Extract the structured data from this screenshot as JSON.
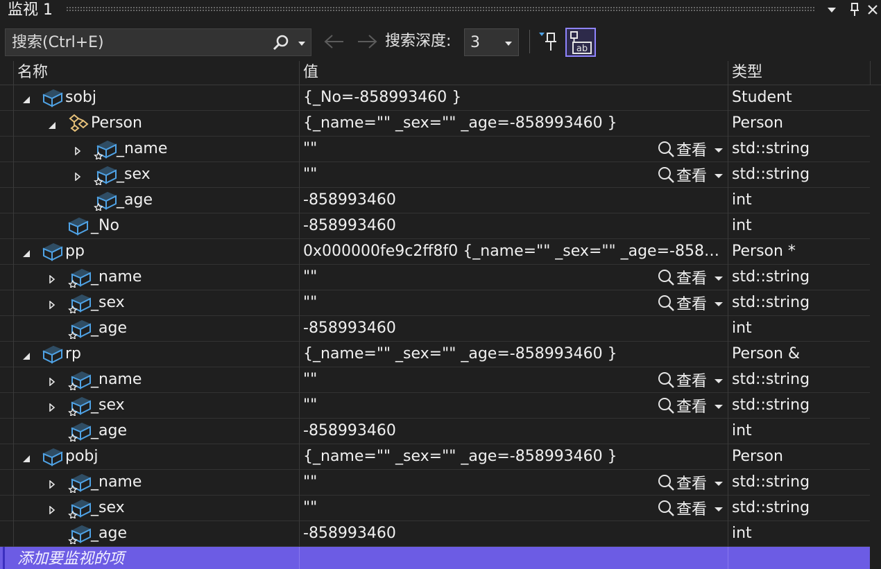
{
  "window": {
    "title": "监视 1"
  },
  "toolbar": {
    "search_placeholder": "搜索(Ctrl+E)",
    "depth_label": "搜索深度:",
    "depth_value": "3"
  },
  "columns": {
    "name": "名称",
    "value": "值",
    "type": "类型"
  },
  "viewer_label": "查看",
  "add_watch_label": "添加要监视的项",
  "rows": [
    {
      "name": "sobj",
      "value": "{_No=-858993460 }",
      "type": "Student",
      "indent": 0,
      "expander": "expanded",
      "icon": "object-icon",
      "viewer": false
    },
    {
      "name": "Person",
      "value": "{_name=\"\" _sex=\"\" _age=-858993460 }",
      "type": "Person",
      "indent": 1,
      "expander": "expanded",
      "icon": "base-class-icon",
      "viewer": false
    },
    {
      "name": "_name",
      "value": "\"\"",
      "type": "std::string",
      "indent": 2,
      "expander": "collapsed",
      "icon": "field-icon",
      "viewer": true
    },
    {
      "name": "_sex",
      "value": "\"\"",
      "type": "std::string",
      "indent": 2,
      "expander": "collapsed",
      "icon": "field-icon",
      "viewer": true
    },
    {
      "name": "_age",
      "value": "-858993460",
      "type": "int",
      "indent": 2,
      "expander": "none",
      "icon": "field-icon",
      "viewer": false
    },
    {
      "name": "_No",
      "value": "-858993460",
      "type": "int",
      "indent": 1,
      "expander": "none",
      "icon": "object-icon",
      "viewer": false
    },
    {
      "name": "pp",
      "value": "0x000000fe9c2ff8f0 {_name=\"\" _sex=\"\" _age=-8589...",
      "type": "Person *",
      "indent": 0,
      "expander": "expanded",
      "icon": "object-icon",
      "viewer": false
    },
    {
      "name": "_name",
      "value": "\"\"",
      "type": "std::string",
      "indent": 1,
      "expander": "collapsed",
      "icon": "field-icon",
      "viewer": true
    },
    {
      "name": "_sex",
      "value": "\"\"",
      "type": "std::string",
      "indent": 1,
      "expander": "collapsed",
      "icon": "field-icon",
      "viewer": true
    },
    {
      "name": "_age",
      "value": "-858993460",
      "type": "int",
      "indent": 1,
      "expander": "none",
      "icon": "field-icon",
      "viewer": false
    },
    {
      "name": "rp",
      "value": "{_name=\"\" _sex=\"\" _age=-858993460 }",
      "type": "Person &",
      "indent": 0,
      "expander": "expanded",
      "icon": "object-icon",
      "viewer": false
    },
    {
      "name": "_name",
      "value": "\"\"",
      "type": "std::string",
      "indent": 1,
      "expander": "collapsed",
      "icon": "field-icon",
      "viewer": true
    },
    {
      "name": "_sex",
      "value": "\"\"",
      "type": "std::string",
      "indent": 1,
      "expander": "collapsed",
      "icon": "field-icon",
      "viewer": true
    },
    {
      "name": "_age",
      "value": "-858993460",
      "type": "int",
      "indent": 1,
      "expander": "none",
      "icon": "field-icon",
      "viewer": false
    },
    {
      "name": "pobj",
      "value": "{_name=\"\" _sex=\"\" _age=-858993460 }",
      "type": "Person",
      "indent": 0,
      "expander": "expanded",
      "icon": "object-icon",
      "viewer": false
    },
    {
      "name": "_name",
      "value": "\"\"",
      "type": "std::string",
      "indent": 1,
      "expander": "collapsed",
      "icon": "field-icon",
      "viewer": true
    },
    {
      "name": "_sex",
      "value": "\"\"",
      "type": "std::string",
      "indent": 1,
      "expander": "collapsed",
      "icon": "field-icon",
      "viewer": true
    },
    {
      "name": "_age",
      "value": "-858993460",
      "type": "int",
      "indent": 1,
      "expander": "none",
      "icon": "field-icon",
      "viewer": false
    }
  ],
  "colors": {
    "background": "#1f1f1f",
    "selection": "#6c5ce4",
    "icon_blue": "#4fa3e6",
    "base_class_icon": "#e8c27a"
  }
}
